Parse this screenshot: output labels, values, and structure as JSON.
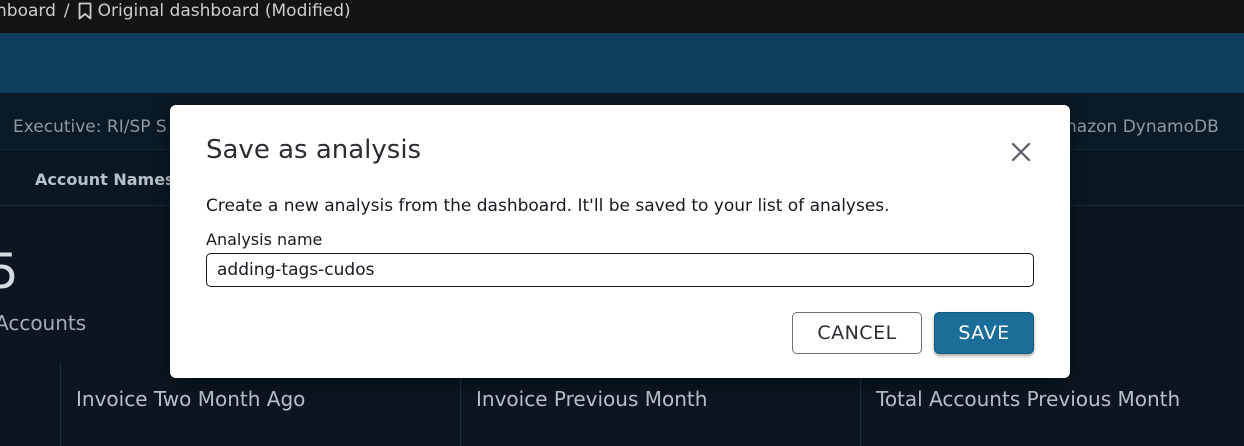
{
  "breadcrumb": {
    "parent": "hboard",
    "separator": "/",
    "current": "Original dashboard (Modified)"
  },
  "sheet_tabs": {
    "left": "Executive: RI/SP S",
    "right": "nazon DynamoDB"
  },
  "controls": {
    "account_names_label": "Account Names"
  },
  "kpi": {
    "value": "5",
    "label": "Accounts"
  },
  "tiles": [
    {
      "title": "Invoice Two Month Ago"
    },
    {
      "title": "Invoice Previous Month"
    },
    {
      "title": "Total Accounts Previous Month"
    }
  ],
  "modal": {
    "title": "Save as analysis",
    "description": "Create a new analysis from the dashboard. It'll be saved to your list of analyses.",
    "field_label": "Analysis name",
    "field_value": "adding-tags-cudos",
    "cancel_label": "CANCEL",
    "save_label": "SAVE"
  },
  "colors": {
    "toolbar": "#0e3f5c",
    "primary_button": "#1b6e9a"
  }
}
